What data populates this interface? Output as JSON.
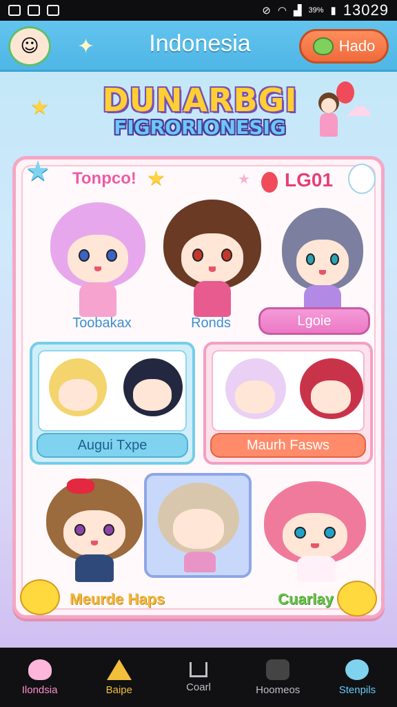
{
  "status": {
    "battery": "39%",
    "time": "13029"
  },
  "header": {
    "title": "Indonesia",
    "button": "Hado"
  },
  "logo": {
    "line1": "DUNARBGI",
    "line2": "FIGRORIONESIG"
  },
  "panel": {
    "tag_left": "Tonpco!",
    "tag_right": "LG01",
    "chars_top": [
      {
        "name": "Toobakax"
      },
      {
        "name": "Ronds"
      },
      {
        "name": "Lgoie"
      }
    ],
    "cards": [
      {
        "label": "Augui Txpe"
      },
      {
        "label": "Maurh Fasws"
      }
    ],
    "bottom_left": "Meurde Haps",
    "bottom_right": "Cuarlay"
  },
  "nav": {
    "items": [
      {
        "label": "Ilondsia"
      },
      {
        "label": "Baipe"
      },
      {
        "label": "Coarl"
      },
      {
        "label": "Hoomeos"
      },
      {
        "label": "Stenpils"
      }
    ]
  },
  "colors": {
    "header": "#4fb6e6",
    "accent_orange": "#f06a3b",
    "panel_border": "#f4a7c4"
  }
}
